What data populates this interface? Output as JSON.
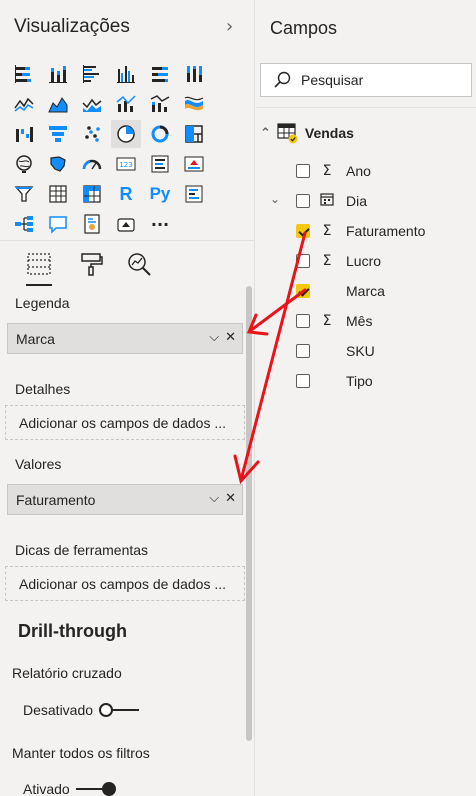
{
  "visualizations": {
    "title": "Visualizações",
    "collapse_icon": "chevron-right-icon",
    "icons": [
      "stacked-bar-chart-icon",
      "stacked-column-chart-icon",
      "clustered-bar-chart-icon",
      "clustered-column-chart-icon",
      "100-stacked-bar-chart-icon",
      "100-stacked-column-chart-icon",
      "line-chart-icon",
      "area-chart-icon",
      "stacked-area-chart-icon",
      "line-clustered-column-chart-icon",
      "line-stacked-column-chart-icon",
      "ribbon-chart-icon",
      "waterfall-chart-icon",
      "funnel-chart-icon",
      "scatter-chart-icon",
      "pie-chart-icon",
      "donut-chart-icon",
      "treemap-icon",
      "map-icon",
      "filled-map-icon",
      "gauge-icon",
      "card-icon",
      "multi-row-card-icon",
      "kpi-icon",
      "slicer-icon",
      "table-icon",
      "matrix-icon",
      "r-script-visual-icon",
      "python-visual-icon",
      "key-influencers-icon",
      "decomposition-tree-icon",
      "qa-icon",
      "paginated-report-icon",
      "power-apps-icon",
      "more-visuals-icon"
    ],
    "r_label": "R",
    "py_label": "Py",
    "card_label": "123",
    "more_label": "···",
    "tabs": [
      "fields-tab-icon",
      "format-paint-roller-icon",
      "analytics-magnifier-icon"
    ],
    "wells": {
      "legend_label": "Legenda",
      "legend_value": "Marca",
      "details_label": "Detalhes",
      "details_placeholder": "Adicionar os campos de dados ...",
      "values_label": "Valores",
      "values_value": "Faturamento",
      "tooltips_label": "Dicas de ferramentas",
      "tooltips_placeholder": "Adicionar os campos de dados ..."
    },
    "drillthrough": {
      "heading": "Drill-through",
      "cross_report_label": "Relatório cruzado",
      "cross_report_state": "Desativado",
      "keep_filters_label": "Manter todos os filtros",
      "keep_filters_state": "Ativado"
    }
  },
  "fields": {
    "title": "Campos",
    "search_placeholder": "Pesquisar",
    "table_name": "Vendas",
    "items": [
      {
        "name": "Ano",
        "type": "sigma",
        "checked": false
      },
      {
        "name": "Dia",
        "type": "calendar",
        "checked": false
      },
      {
        "name": "Faturamento",
        "type": "sigma",
        "checked": true
      },
      {
        "name": "Lucro",
        "type": "sigma",
        "checked": false
      },
      {
        "name": "Marca",
        "type": "none",
        "checked": true
      },
      {
        "name": "Mês",
        "type": "sigma",
        "checked": false
      },
      {
        "name": "SKU",
        "type": "none",
        "checked": false
      },
      {
        "name": "Tipo",
        "type": "none",
        "checked": false
      }
    ]
  },
  "colors": {
    "accent": "#f2c811",
    "icon_blue": "#118dff",
    "annotation_arrow": "#e8141a"
  }
}
